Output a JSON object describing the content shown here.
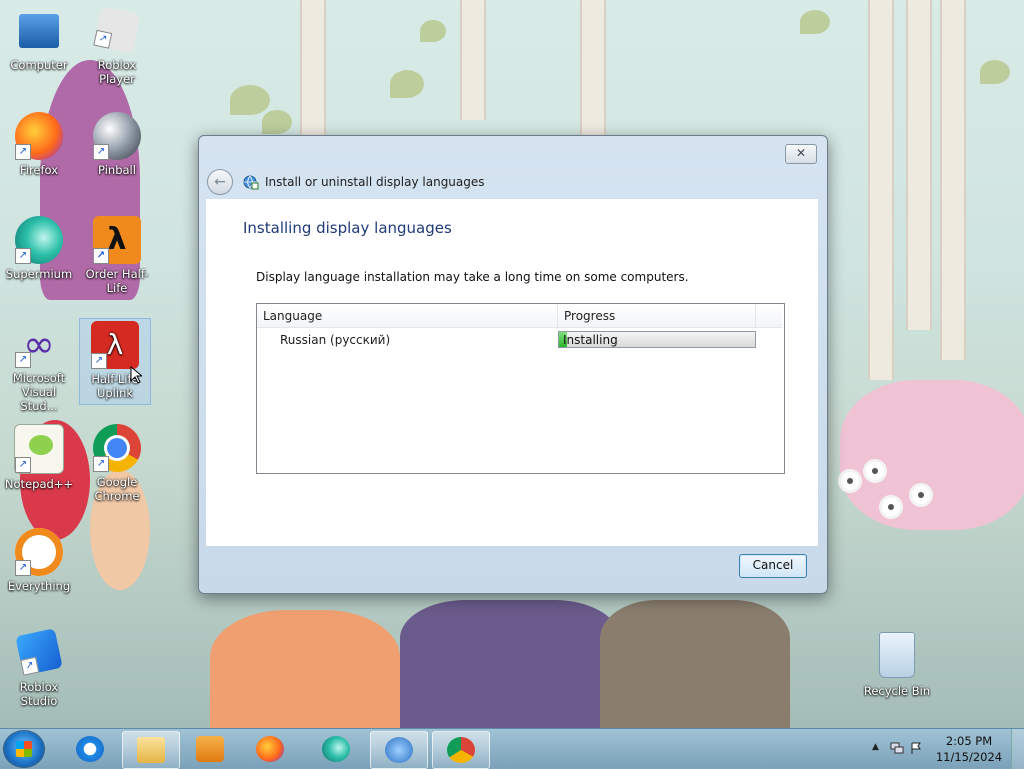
{
  "desktop": {
    "icons": [
      {
        "label": "Computer"
      },
      {
        "label": "Roblox Player"
      },
      {
        "label": "Firefox"
      },
      {
        "label": "Pinball"
      },
      {
        "label": "Supermium"
      },
      {
        "label": "Order Half-Life"
      },
      {
        "label": "Microsoft Visual Stud..."
      },
      {
        "label": "Half-Life Uplink"
      },
      {
        "label": "Notepad++"
      },
      {
        "label": "Google Chrome"
      },
      {
        "label": "Everything"
      },
      {
        "label": "Roblox Studio"
      },
      {
        "label": "Recycle Bin"
      }
    ]
  },
  "dialog": {
    "close_glyph": "✕",
    "back_glyph": "←",
    "title": "Install or uninstall display languages",
    "main_instruction": "Installing display languages",
    "description": "Display language installation may take a long time on some computers.",
    "columns": [
      "Language",
      "Progress"
    ],
    "rows": [
      {
        "language": "Russian (русский)",
        "status": "Installing",
        "progress_fraction": 0.04
      }
    ],
    "cancel_label": "Cancel"
  },
  "taskbar": {
    "pinned": [
      "Internet Explorer",
      "Windows Explorer",
      "Windows Media Player",
      "Firefox",
      "Supermium",
      "Install or uninstall display languages",
      "Google Chrome"
    ],
    "tray_expand_glyph": "▲",
    "clock": {
      "time": "2:05 PM",
      "date": "11/15/2024"
    }
  }
}
